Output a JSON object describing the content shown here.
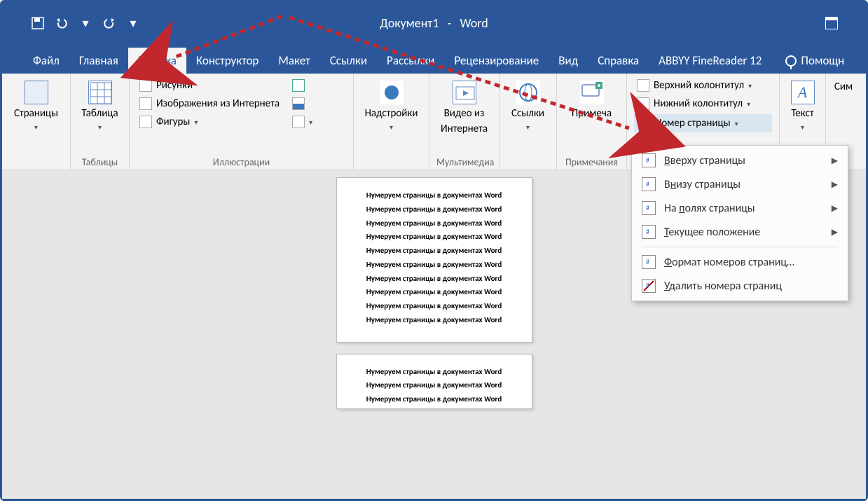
{
  "title": {
    "doc": "Документ1",
    "sep": "-",
    "app": "Word"
  },
  "qat": {
    "save": "save",
    "undo": "undo",
    "redo": "redo",
    "customize": "customize"
  },
  "tabs": [
    {
      "label": "Файл"
    },
    {
      "label": "Главная"
    },
    {
      "label": "Вставка",
      "active": true
    },
    {
      "label": "Конструктор"
    },
    {
      "label": "Макет"
    },
    {
      "label": "Ссылки"
    },
    {
      "label": "Рассылки"
    },
    {
      "label": "Рецензирование"
    },
    {
      "label": "Вид"
    },
    {
      "label": "Справка"
    },
    {
      "label": "ABBYY FineReader 12"
    }
  ],
  "tell_me": "Помощн",
  "ribbon": {
    "pages": {
      "btn": "Страницы",
      "group": ""
    },
    "tables": {
      "btn": "Таблица",
      "group": "Таблицы"
    },
    "illustr": {
      "pictures": "Рисунки",
      "online_pics": "Изображения из Интернета",
      "shapes": "Фигуры",
      "group": "Иллюстрации"
    },
    "addins": {
      "btn": "Надстройки",
      "group": ""
    },
    "media": {
      "btn1": "Видео из",
      "btn2": "Интернета",
      "group": "Мультимедиа"
    },
    "links": {
      "btn": "Ссылки",
      "group": ""
    },
    "comments": {
      "btn": "Примеча",
      "group": "Примечания"
    },
    "headerfooter": {
      "header": "Верхний колонтитул",
      "footer": "Нижний колонтитул",
      "pagenum": "Номер страницы",
      "group": ""
    },
    "text": {
      "btn": "Текст",
      "group": ""
    },
    "symbols": {
      "btn": "Сим",
      "group": ""
    }
  },
  "doc_lines": [
    "Нумеруем страницы в документах Word",
    "Нумеруем страницы в документах Word",
    "Нумеруем страницы в документах Word",
    "Нумеруем страницы в документах Word",
    "Нумеруем страницы в документах Word",
    "Нумеруем страницы в документах Word",
    "Нумеруем страницы в документах Word",
    "Нумеруем страницы в документах Word",
    "Нумеруем страницы в документах Word",
    "Нумеруем страницы в документах Word"
  ],
  "doc_lines2": [
    "Нумеруем страницы в документах Word",
    "Нумеруем страницы в документах Word",
    "Нумеруем страницы в документах Word"
  ],
  "menu": {
    "top": "Вверху страницы",
    "top_u": "В",
    "bottom": "Внизу страницы",
    "bottom_rest": "низу страницы",
    "margins": "На полях страницы",
    "margins_u": "п",
    "current": "Текущее положение",
    "current_u": "Т",
    "format": "Формат номеров страниц…",
    "format_u": "Ф",
    "remove": "Удалить номера страниц",
    "remove_u": "У"
  }
}
